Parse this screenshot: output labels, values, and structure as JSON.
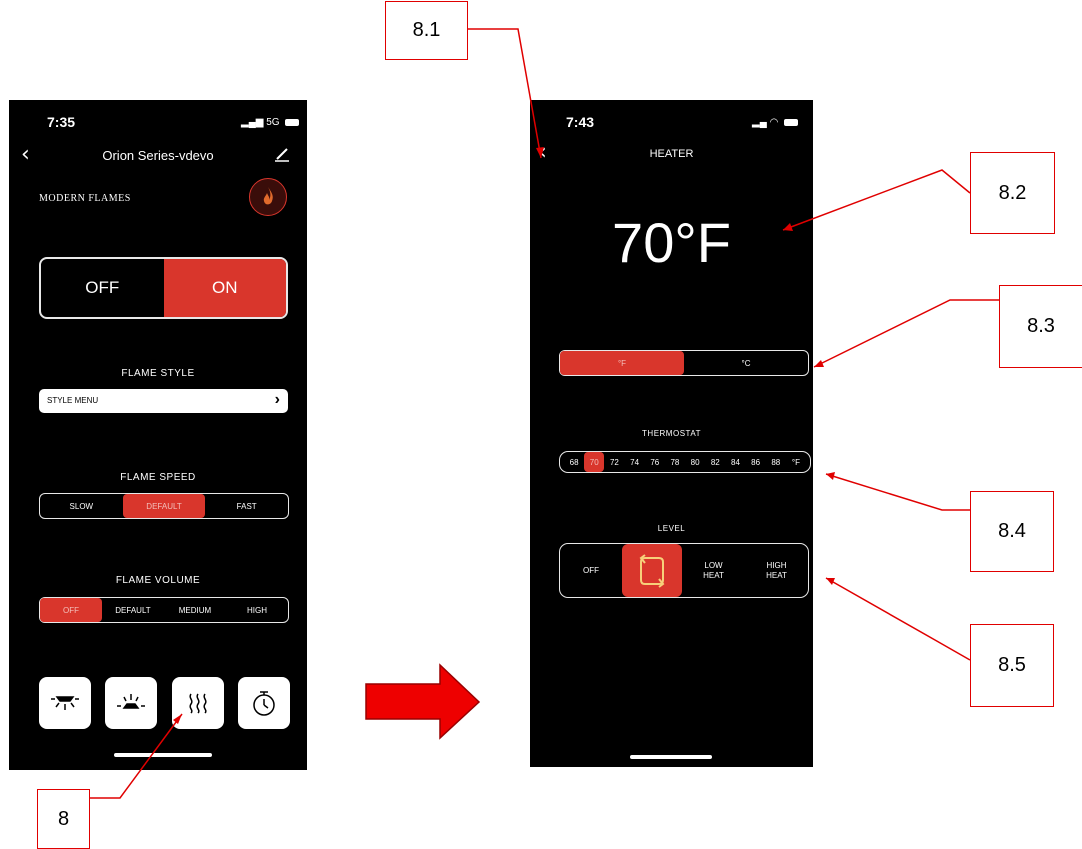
{
  "phone1": {
    "status_time": "7:35",
    "status_signal": "5G",
    "nav_title": "Orion Series-vdevo",
    "brand_logo": "MODERN FLAMES",
    "power": {
      "off": "OFF",
      "on": "ON",
      "selected": "ON"
    },
    "flame_style": {
      "label": "FLAME STYLE",
      "menu": "STYLE MENU"
    },
    "flame_speed": {
      "label": "FLAME SPEED",
      "options": [
        "SLOW",
        "DEFAULT",
        "FAST"
      ],
      "selected": "DEFAULT"
    },
    "flame_volume": {
      "label": "FLAME VOLUME",
      "options": [
        "OFF",
        "DEFAULT",
        "MEDIUM",
        "HIGH"
      ],
      "selected": "OFF"
    },
    "bottom_icons": [
      "ceiling-light-icon",
      "ember-light-icon",
      "heater-icon",
      "timer-icon"
    ]
  },
  "phone2": {
    "status_time": "7:43",
    "nav_title": "HEATER",
    "temperature": "70°F",
    "units": {
      "options": [
        "°F",
        "°C"
      ],
      "selected": "°F"
    },
    "thermostat": {
      "label": "THERMOSTAT",
      "values": [
        "68",
        "70",
        "72",
        "74",
        "76",
        "78",
        "80",
        "82",
        "84",
        "86",
        "88",
        "°F"
      ],
      "selected": "70"
    },
    "level": {
      "label": "LEVEL",
      "off": "OFF",
      "low": [
        "LOW",
        "HEAT"
      ],
      "high": [
        "HIGH",
        "HEAT"
      ],
      "selected": "auto"
    }
  },
  "callouts": {
    "c8": "8",
    "c81": "8.1",
    "c82": "8.2",
    "c83": "8.3",
    "c84": "8.4",
    "c85": "8.5"
  },
  "colors": {
    "accent_red": "#d9362c",
    "callout_red": "#e00000"
  }
}
